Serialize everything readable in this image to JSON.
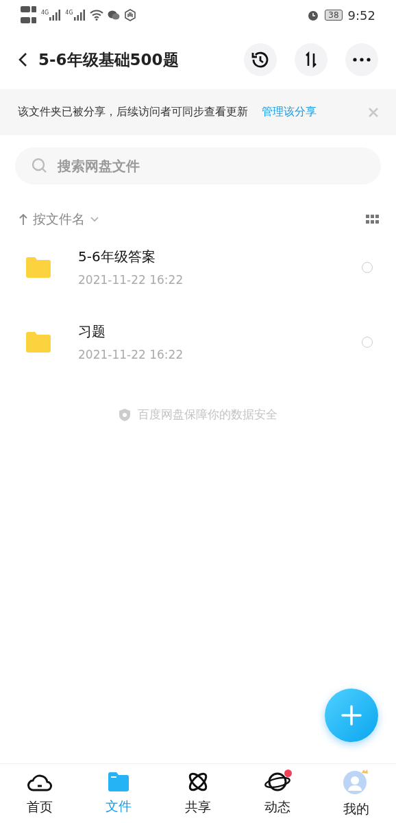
{
  "status_bar": {
    "signal_labels": [
      "4G",
      "4G"
    ],
    "battery": "38",
    "time": "9:52"
  },
  "header": {
    "title": "5-6年级基础500题"
  },
  "share_banner": {
    "message": "该文件夹已被分享，后续访问者可同步查看更新",
    "link": "管理该分享"
  },
  "search": {
    "placeholder": "搜索网盘文件"
  },
  "sort": {
    "label": "按文件名"
  },
  "files": [
    {
      "name": "5-6年级答案",
      "date": "2021-11-22  16:22",
      "selected": false
    },
    {
      "name": "习题",
      "date": "2021-11-22  16:22",
      "selected": false
    }
  ],
  "footer_note": "百度网盘保障你的数据安全",
  "tabs": [
    {
      "label": "首页",
      "kind": "cloud",
      "selected": false,
      "badge": false
    },
    {
      "label": "文件",
      "kind": "folder",
      "selected": true,
      "badge": false
    },
    {
      "label": "共享",
      "kind": "atom",
      "selected": false,
      "badge": false
    },
    {
      "label": "动态",
      "kind": "planet",
      "selected": false,
      "badge": true
    },
    {
      "label": "我的",
      "kind": "avatar",
      "selected": false,
      "badge": false
    }
  ]
}
